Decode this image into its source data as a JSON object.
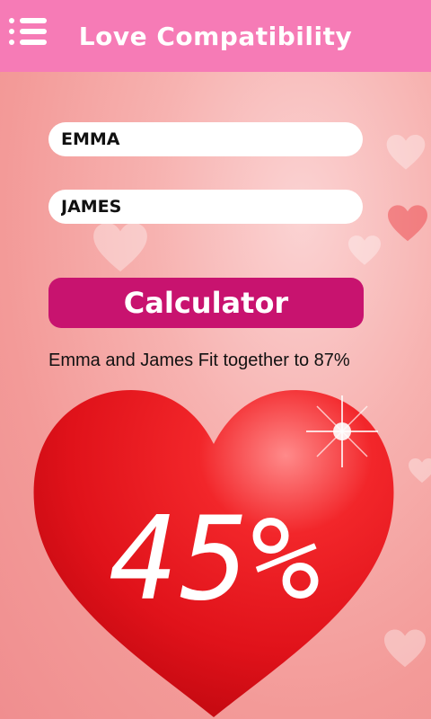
{
  "header": {
    "title": "Love Compatibility",
    "menu_icon": "menu-list-icon",
    "background": "#f67bb6"
  },
  "form": {
    "name1": "EMMA",
    "name2": "JAMES",
    "calculate_label": "Calculator",
    "button_color": "#c8136f"
  },
  "result": {
    "text": "Emma and James Fit together to 87%",
    "percentage": "45%",
    "heart_color": "#e8131b"
  }
}
